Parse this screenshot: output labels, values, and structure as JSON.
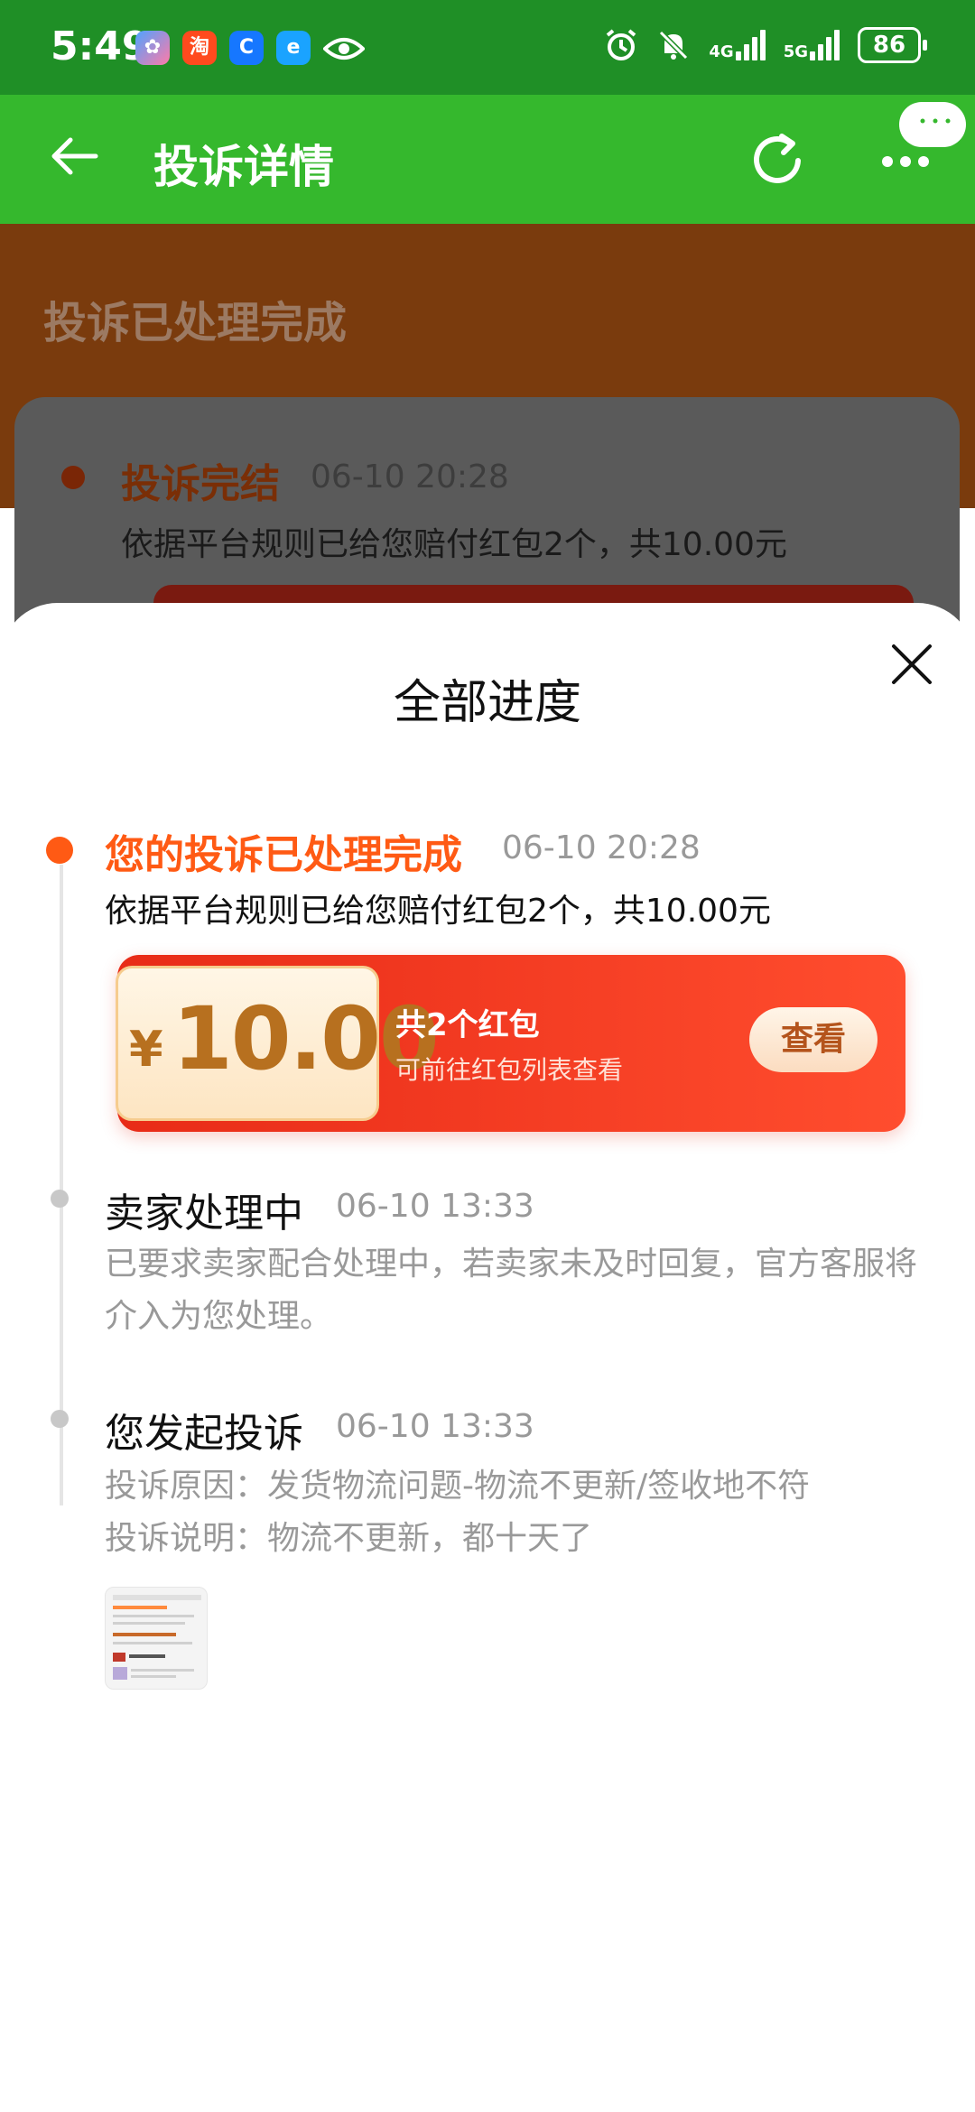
{
  "status_bar": {
    "time": "5:49",
    "network_1": "4G",
    "network_2": "5G",
    "battery": "86",
    "app_icon_taobao": "淘"
  },
  "header": {
    "title": "投诉详情"
  },
  "background": {
    "status_title": "投诉已处理完成",
    "item_title": "投诉完结",
    "item_time": "06-10 20:28",
    "item_desc": "依据平台规则已给您赔付红包2个，共10.00元"
  },
  "sheet": {
    "title": "全部进度",
    "steps": [
      {
        "title": "您的投诉已处理完成",
        "time": "06-10 20:28",
        "desc": "依据平台规则已给您赔付红包2个，共10.00元"
      },
      {
        "title": "卖家处理中",
        "time": "06-10 13:33",
        "desc": "已要求卖家配合处理中，若卖家未及时回复，官方客服将介入为您处理。"
      },
      {
        "title": "您发起投诉",
        "time": "06-10 13:33",
        "reason": "投诉原因：发货物流问题-物流不更新/签收地不符",
        "explain": "投诉说明：物流不更新，都十天了"
      }
    ],
    "coupon": {
      "currency": "¥",
      "amount": "10.00",
      "count_text": "共2个红包",
      "note": "可前往红包列表查看",
      "button": "查看"
    }
  },
  "colors": {
    "status_bar": "#1f8f26",
    "header": "#35b82d",
    "accent": "#ff5a14",
    "coupon_red": "#e82b17"
  }
}
